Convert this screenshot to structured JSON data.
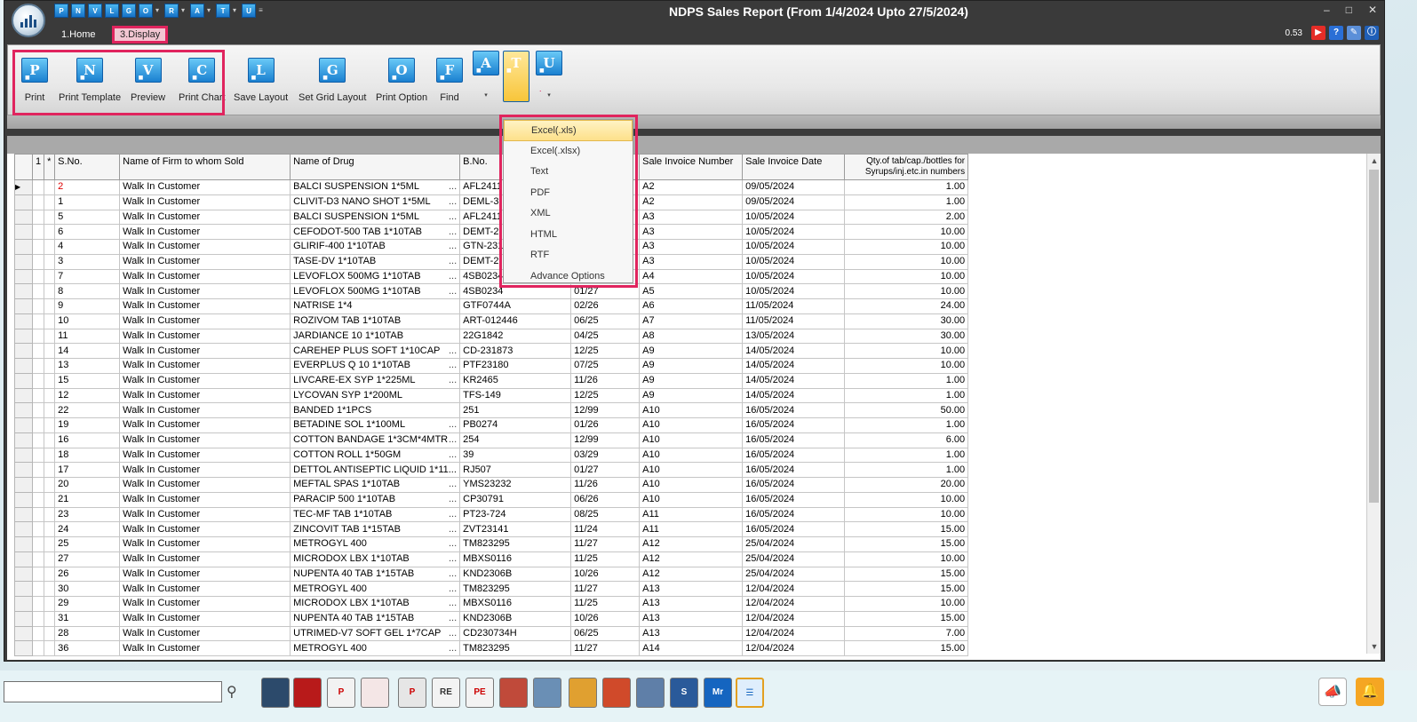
{
  "window": {
    "title": "NDPS Sales Report (From 1/4/2024 Upto 27/5/2024)",
    "version": "0.53"
  },
  "quick_access": [
    "P",
    "N",
    "V",
    "L",
    "G",
    "O",
    "R",
    "A",
    "T",
    "U"
  ],
  "tabs": [
    {
      "label": "1.Home"
    },
    {
      "label": "3.Display"
    }
  ],
  "ribbon": {
    "buttons": [
      {
        "letter": "P",
        "label": "Print"
      },
      {
        "letter": "N",
        "label": "Print Template"
      },
      {
        "letter": "V",
        "label": "Preview"
      },
      {
        "letter": "C",
        "label": "Print Chart"
      },
      {
        "letter": "L",
        "label": "Save Layout"
      },
      {
        "letter": "G",
        "label": "Set Grid Layout"
      },
      {
        "letter": "O",
        "label": "Print Option"
      },
      {
        "letter": "F",
        "label": "Find"
      },
      {
        "letter": "A",
        "label": ""
      },
      {
        "letter": "T",
        "label": ""
      },
      {
        "letter": "U",
        "label": ""
      }
    ]
  },
  "export_menu": {
    "items": [
      "Excel(.xls)",
      "Excel(.xlsx)",
      "Text",
      "PDF",
      "XML",
      "HTML",
      "RTF",
      "Advance Options"
    ],
    "highlighted": "Excel(.xls)"
  },
  "grid": {
    "headers": [
      "1",
      "*",
      "S.No.",
      "Name of Firm to whom Sold",
      "Name of Drug",
      "B.No.",
      "",
      "Sale Invoice Number",
      "Sale Invoice Date",
      "Qty.of tab/cap./bottles for Syrups/inj.etc.in numbers"
    ],
    "rows": [
      [
        "2",
        "Walk In Customer",
        "BALCI SUSPENSION 1*5ML",
        "AFL2411",
        "",
        "A2",
        "09/05/2024",
        "1.00"
      ],
      [
        "1",
        "Walk In Customer",
        "CLIVIT-D3 NANO SHOT 1*5ML",
        "DEML-3",
        "",
        "A2",
        "09/05/2024",
        "1.00"
      ],
      [
        "5",
        "Walk In Customer",
        "BALCI SUSPENSION 1*5ML",
        "AFL2411",
        "",
        "A3",
        "10/05/2024",
        "2.00"
      ],
      [
        "6",
        "Walk In Customer",
        "CEFODOT-500 TAB 1*10TAB",
        "DEMT-2",
        "",
        "A3",
        "10/05/2024",
        "10.00"
      ],
      [
        "4",
        "Walk In Customer",
        "GLIRIF-400 1*10TAB",
        "GTN-231",
        "",
        "A3",
        "10/05/2024",
        "10.00"
      ],
      [
        "3",
        "Walk In Customer",
        "TASE-DV 1*10TAB",
        "DEMT-2",
        "",
        "A3",
        "10/05/2024",
        "10.00"
      ],
      [
        "7",
        "Walk In Customer",
        "LEVOFLOX 500MG 1*10TAB",
        "4SB0234",
        "",
        "A4",
        "10/05/2024",
        "10.00"
      ],
      [
        "8",
        "Walk In Customer",
        "LEVOFLOX 500MG 1*10TAB",
        "4SB0234",
        "01/27",
        "A5",
        "10/05/2024",
        "10.00"
      ],
      [
        "9",
        "Walk In Customer",
        "NATRISE 1*4",
        "GTF0744A",
        "02/26",
        "A6",
        "11/05/2024",
        "24.00"
      ],
      [
        "10",
        "Walk In Customer",
        "ROZIVOM TAB 1*10TAB",
        "ART-012446",
        "06/25",
        "A7",
        "11/05/2024",
        "30.00"
      ],
      [
        "11",
        "Walk In Customer",
        "JARDIANCE 10 1*10TAB",
        "22G1842",
        "04/25",
        "A8",
        "13/05/2024",
        "30.00"
      ],
      [
        "14",
        "Walk In Customer",
        "CAREHEP PLUS SOFT 1*10CAP",
        "CD-231873",
        "12/25",
        "A9",
        "14/05/2024",
        "10.00"
      ],
      [
        "13",
        "Walk In Customer",
        "EVERPLUS Q 10 1*10TAB",
        "PTF23180",
        "07/25",
        "A9",
        "14/05/2024",
        "10.00"
      ],
      [
        "15",
        "Walk In Customer",
        "LIVCARE-EX SYP 1*225ML",
        "KR2465",
        "11/26",
        "A9",
        "14/05/2024",
        "1.00"
      ],
      [
        "12",
        "Walk In Customer",
        "LYCOVAN SYP 1*200ML",
        "TFS-149",
        "12/25",
        "A9",
        "14/05/2024",
        "1.00"
      ],
      [
        "22",
        "Walk In Customer",
        "BANDED 1*1PCS",
        "251",
        "12/99",
        "A10",
        "16/05/2024",
        "50.00"
      ],
      [
        "19",
        "Walk In Customer",
        "BETADINE SOL 1*100ML",
        "PB0274",
        "01/26",
        "A10",
        "16/05/2024",
        "1.00"
      ],
      [
        "16",
        "Walk In Customer",
        "COTTON BANDAGE 1*3CM*4MTR",
        "254",
        "12/99",
        "A10",
        "16/05/2024",
        "6.00"
      ],
      [
        "18",
        "Walk In Customer",
        "COTTON ROLL 1*50GM",
        "39",
        "03/29",
        "A10",
        "16/05/2024",
        "1.00"
      ],
      [
        "17",
        "Walk In Customer",
        "DETTOL ANTISEPTIC LIQUID 1*11...",
        "RJ507",
        "01/27",
        "A10",
        "16/05/2024",
        "1.00"
      ],
      [
        "20",
        "Walk In Customer",
        "MEFTAL SPAS 1*10TAB",
        "YMS23232",
        "11/26",
        "A10",
        "16/05/2024",
        "20.00"
      ],
      [
        "21",
        "Walk In Customer",
        "PARACIP 500 1*10TAB",
        "CP30791",
        "06/26",
        "A10",
        "16/05/2024",
        "10.00"
      ],
      [
        "23",
        "Walk In Customer",
        "TEC-MF TAB 1*10TAB",
        "PT23-724",
        "08/25",
        "A11",
        "16/05/2024",
        "10.00"
      ],
      [
        "24",
        "Walk In Customer",
        "ZINCOVIT TAB 1*15TAB",
        "ZVT23141",
        "11/24",
        "A11",
        "16/05/2024",
        "15.00"
      ],
      [
        "25",
        "Walk In Customer",
        "METROGYL 400",
        "TM823295",
        "11/27",
        "A12",
        "25/04/2024",
        "15.00"
      ],
      [
        "27",
        "Walk In Customer",
        "MICRODOX LBX 1*10TAB",
        "MBXS0116",
        "11/25",
        "A12",
        "25/04/2024",
        "10.00"
      ],
      [
        "26",
        "Walk In Customer",
        "NUPENTA 40 TAB 1*15TAB",
        "KND2306B",
        "10/26",
        "A12",
        "25/04/2024",
        "15.00"
      ],
      [
        "30",
        "Walk In Customer",
        "METROGYL 400",
        "TM823295",
        "11/27",
        "A13",
        "12/04/2024",
        "15.00"
      ],
      [
        "29",
        "Walk In Customer",
        "MICRODOX LBX 1*10TAB",
        "MBXS0116",
        "11/25",
        "A13",
        "12/04/2024",
        "10.00"
      ],
      [
        "31",
        "Walk In Customer",
        "NUPENTA 40 TAB 1*15TAB",
        "KND2306B",
        "10/26",
        "A13",
        "12/04/2024",
        "15.00"
      ],
      [
        "28",
        "Walk In Customer",
        "UTRIMED-V7 SOFT GEL 1*7CAP",
        "CD230734H",
        "06/25",
        "A13",
        "12/04/2024",
        "7.00"
      ],
      [
        "36",
        "Walk In Customer",
        "METROGYL 400",
        "TM823295",
        "11/27",
        "A14",
        "12/04/2024",
        "15.00"
      ]
    ]
  },
  "colors": {
    "accent_pink": "#e0245e",
    "ribbon_blue": "#1a80d0",
    "highlight_yellow": "#fde08a"
  }
}
